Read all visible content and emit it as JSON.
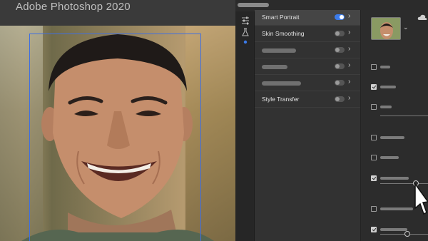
{
  "window": {
    "title": "Adobe Photoshop 2020"
  },
  "colors": {
    "accent": "#3b7bea",
    "selection": "#3f6fe0",
    "panel": "#323232",
    "panel_selected": "#454545"
  },
  "icon_strip": {
    "icons": [
      "sliders-icon",
      "beaker-icon",
      "dot-indicator-icon"
    ]
  },
  "neural_filters": {
    "items": [
      {
        "label": "Smart Portrait",
        "enabled": true,
        "selected": true
      },
      {
        "label": "Skin Smoothing",
        "enabled": false,
        "selected": false
      },
      {
        "label": "",
        "enabled": false,
        "selected": false
      },
      {
        "label": "",
        "enabled": false,
        "selected": false
      },
      {
        "label": "",
        "enabled": false,
        "selected": false
      },
      {
        "label": "Style Transfer",
        "enabled": false,
        "selected": false
      }
    ]
  },
  "properties": {
    "checkboxes": [
      {
        "checked": false
      },
      {
        "checked": true
      },
      {
        "checked": false
      },
      {
        "checked": false
      },
      {
        "checked": false
      },
      {
        "checked": true
      },
      {
        "checked": false
      },
      {
        "checked": true
      }
    ],
    "sliders": [
      {
        "value": 0.7
      },
      {
        "value": 0.55
      }
    ]
  }
}
